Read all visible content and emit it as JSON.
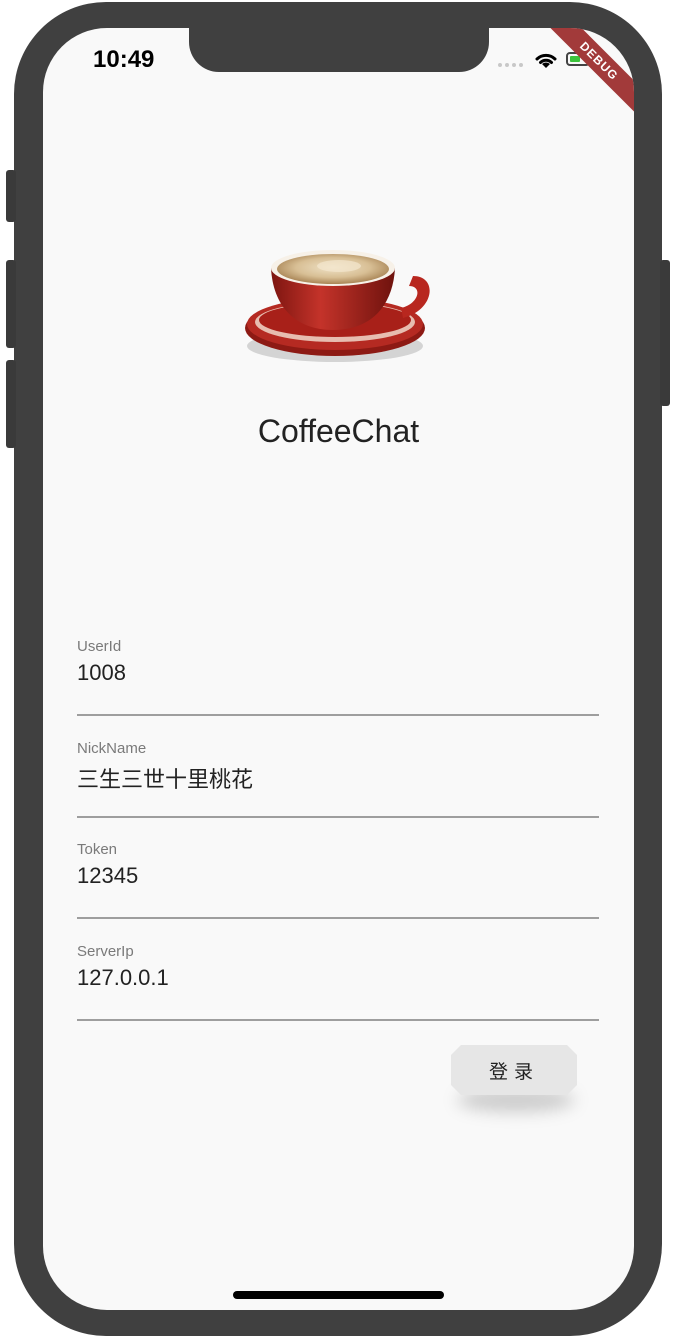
{
  "status_bar": {
    "time": "10:49",
    "debug_label": "DEBUG"
  },
  "app": {
    "title": "CoffeeChat",
    "logo": "coffee-cup-icon"
  },
  "form": {
    "fields": [
      {
        "label": "UserId",
        "value": "1008"
      },
      {
        "label": "NickName",
        "value": "三生三世十里桃花"
      },
      {
        "label": "Token",
        "value": "12345"
      },
      {
        "label": "ServerIp",
        "value": "127.0.0.1"
      }
    ],
    "login_label": "登录"
  },
  "colors": {
    "background": "#f9f9f9",
    "frame": "#404040",
    "debug_ribbon": "#a23a3a",
    "cup_red": "#b3261e"
  }
}
